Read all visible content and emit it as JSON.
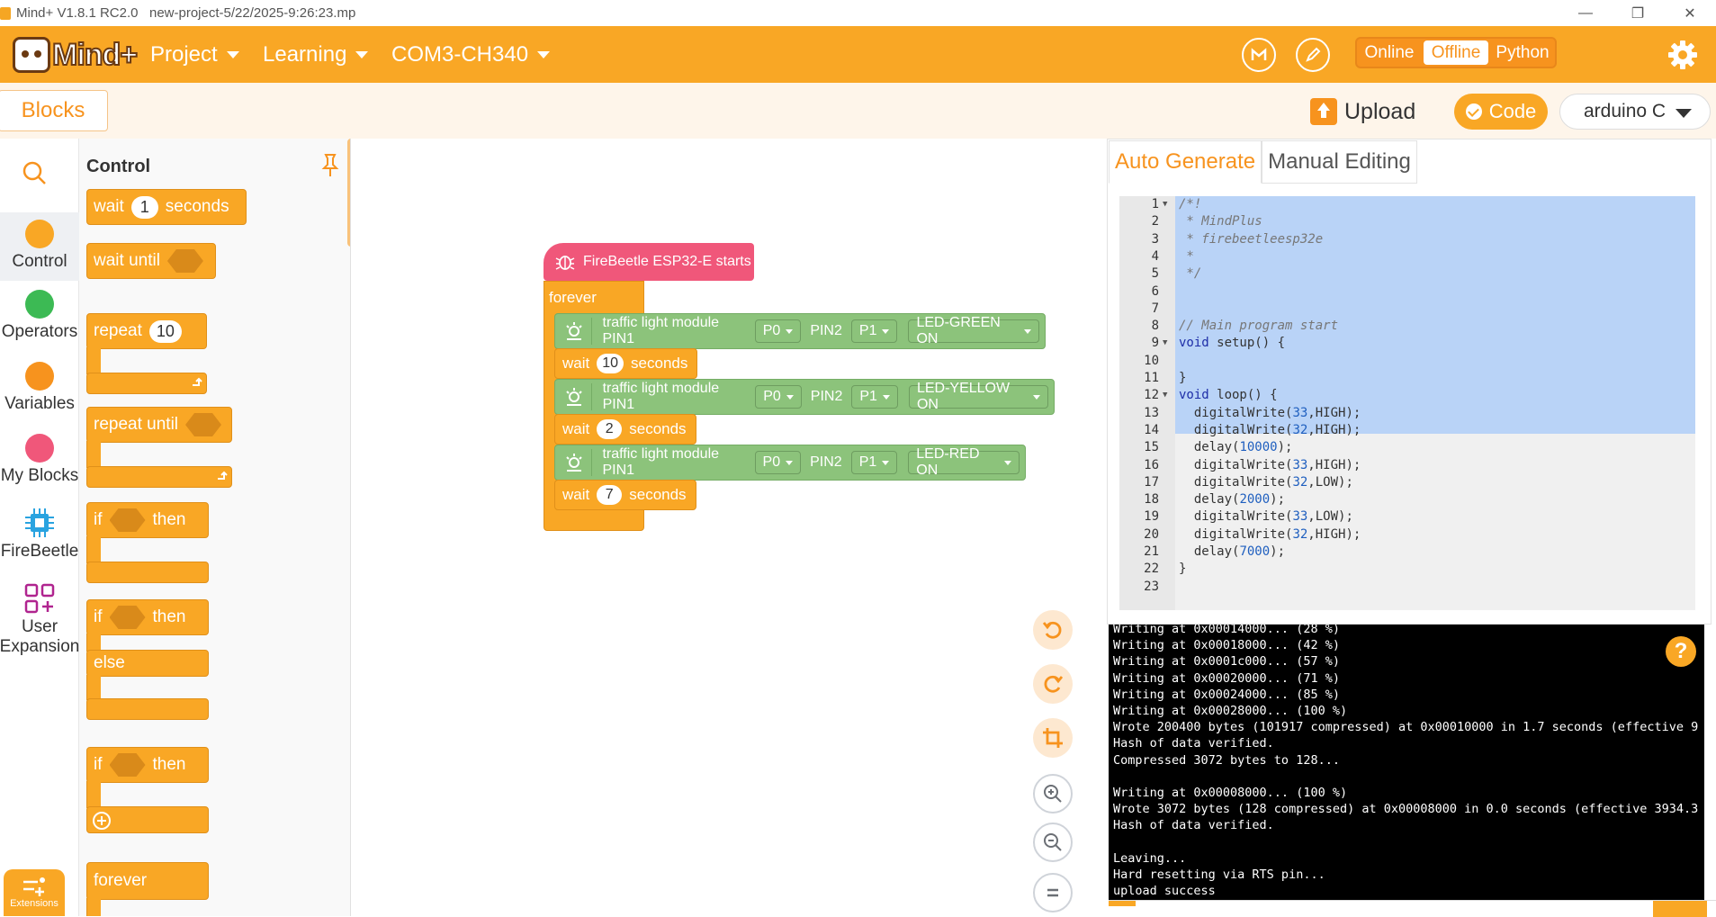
{
  "window": {
    "title": "Mind+ V1.8.1 RC2.0   new-project-5/22/2025-9:26:23.mp",
    "controls": [
      "—",
      "❐",
      "✕"
    ]
  },
  "header": {
    "logo_text": "Mind+",
    "menus": [
      {
        "label": "Project"
      },
      {
        "label": "Learning"
      },
      {
        "label": "COM3-CH340"
      }
    ],
    "modes": [
      {
        "label": "Online",
        "active": false
      },
      {
        "label": "Offline",
        "active": true
      },
      {
        "label": "Python",
        "active": false
      }
    ],
    "accent": "#f9a725"
  },
  "toolbar": {
    "blocks_tab": "Blocks",
    "upload_label": "Upload",
    "code_label": "Code",
    "language": "arduino C"
  },
  "categories": [
    {
      "label": "Control",
      "color": "#f9a725",
      "active": true
    },
    {
      "label": "Operators",
      "color": "#3cba54"
    },
    {
      "label": "Variables",
      "color": "#f7931e"
    },
    {
      "label": "My Blocks",
      "color": "#f0577a"
    },
    {
      "label": "FireBeetle",
      "icon": "chip-icon"
    },
    {
      "label_line1": "User",
      "label_line2": "Expansion",
      "icon": "extension-icon"
    }
  ],
  "extensions_label": "Extensions",
  "palette": {
    "title": "Control",
    "wait_1": {
      "label": "wait",
      "value": "1",
      "suffix": "seconds"
    },
    "wait_until": "wait until",
    "repeat": {
      "label": "repeat",
      "value": "10"
    },
    "repeat_until": "repeat until",
    "if_then_1": {
      "if": "if",
      "then": "then"
    },
    "if_then_else": {
      "if": "if",
      "then": "then",
      "else": "else"
    },
    "if_then_plus": {
      "if": "if",
      "then": "then"
    },
    "forever": "forever"
  },
  "workspace": {
    "hat_label": "FireBeetle ESP32-E starts",
    "forever_label": "forever",
    "steps": [
      {
        "module": "traffic light module PIN1",
        "pin1": "P0",
        "pin2_label": "PIN2",
        "pin2": "P1",
        "state": "LED-GREEN ON",
        "wait": "wait",
        "seconds": "10",
        "unit": "seconds"
      },
      {
        "module": "traffic light module PIN1",
        "pin1": "P0",
        "pin2_label": "PIN2",
        "pin2": "P1",
        "state": "LED-YELLOW ON",
        "wait": "wait",
        "seconds": "2",
        "unit": "seconds"
      },
      {
        "module": "traffic light module PIN1",
        "pin1": "P0",
        "pin2_label": "PIN2",
        "pin2": "P1",
        "state": "LED-RED ON",
        "wait": "wait",
        "seconds": "7",
        "unit": "seconds"
      }
    ]
  },
  "code": {
    "tabs": [
      {
        "label": "Auto Generate",
        "active": true
      },
      {
        "label": "Manual Editing",
        "active": false
      }
    ],
    "lines": [
      "/*!",
      " * MindPlus",
      " * firebeetleesp32e",
      " *",
      " */",
      "",
      "",
      "// Main program start",
      "void setup() {",
      "",
      "}",
      "void loop() {",
      "  digitalWrite(33,HIGH);",
      "  digitalWrite(32,HIGH);",
      "  delay(10000);",
      "  digitalWrite(33,HIGH);",
      "  digitalWrite(32,LOW);",
      "  delay(2000);",
      "  digitalWrite(33,LOW);",
      "  digitalWrite(32,HIGH);",
      "  delay(7000);",
      "}",
      ""
    ]
  },
  "console": {
    "lines": [
      "Writing at 0x00014000... (28 %)",
      "Writing at 0x00018000... (42 %)",
      "Writing at 0x0001c000... (57 %)",
      "Writing at 0x00020000... (71 %)",
      "Writing at 0x00024000... (85 %)",
      "Writing at 0x00028000... (100 %)",
      "Wrote 200400 bytes (101917 compressed) at 0x00010000 in 1.7 seconds (effective 9",
      "Hash of data verified.",
      "Compressed 3072 bytes to 128...",
      "",
      "Writing at 0x00008000... (100 %)",
      "Wrote 3072 bytes (128 compressed) at 0x00008000 in 0.0 seconds (effective 3934.3",
      "Hash of data verified.",
      "",
      "Leaving...",
      "Hard resetting via RTS pin...",
      "upload success"
    ],
    "help": "?"
  }
}
